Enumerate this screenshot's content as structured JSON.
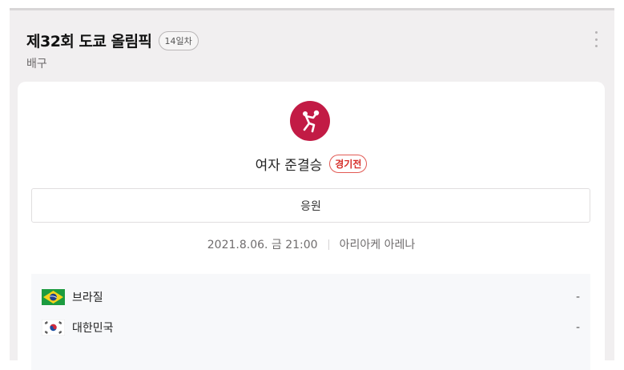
{
  "header": {
    "title": "제32회 도쿄 올림픽",
    "day_badge": "14일차",
    "sport": "배구"
  },
  "match": {
    "sport_icon": "volleyball-icon",
    "event": "여자 준결승",
    "event_badge": "경기전",
    "cheer_label": "응원",
    "datetime": "2021.8.06. 금 21:00",
    "venue": "아리아케 아레나"
  },
  "teams": [
    {
      "name": "브라질",
      "flag": "brazil-flag",
      "score": "-"
    },
    {
      "name": "대한민국",
      "flag": "korea-flag",
      "score": "-"
    }
  ],
  "colors": {
    "accent": "#c21b45",
    "badge_red": "#d62f2a",
    "panel_bg": "#f1eff0"
  }
}
